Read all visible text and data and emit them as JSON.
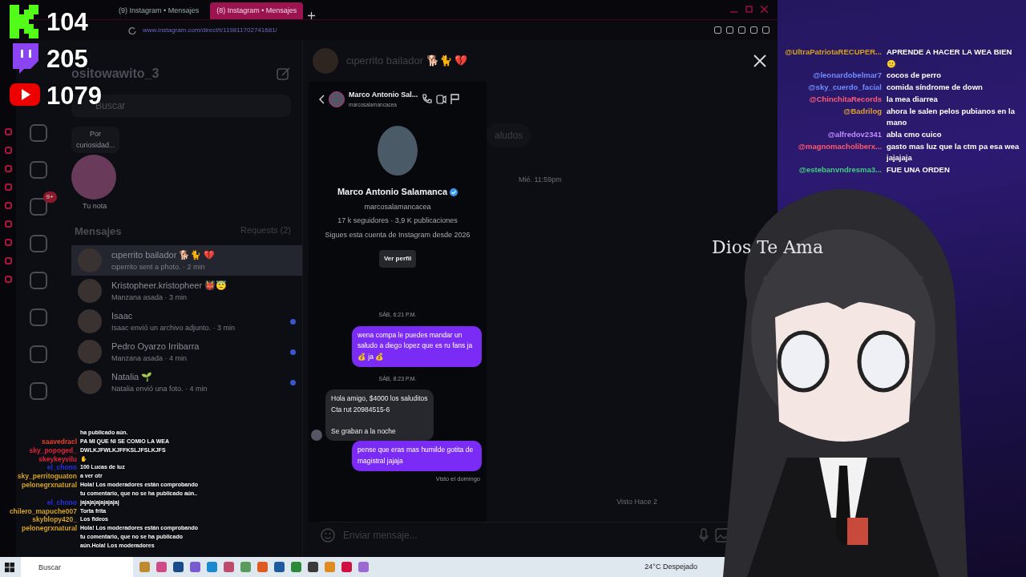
{
  "browser": {
    "tabs": [
      {
        "label": "(9) Instagram • Mensajes",
        "selected": false
      },
      {
        "label": "(8) Instagram • Mensajes",
        "selected": true
      }
    ],
    "url": "www.instagram.com/direct/t/119811702741681/"
  },
  "stream_counters": [
    {
      "kind": "kick",
      "count": "104"
    },
    {
      "kind": "twitch",
      "count": "205"
    },
    {
      "kind": "youtube",
      "count": "1079"
    }
  ],
  "instagram": {
    "username": "ositowawito_3",
    "nav_badge": "9+",
    "search": {
      "placeholder": "Buscar"
    },
    "note": {
      "bubble": "Por curiosidad...",
      "label": "Tu nota"
    },
    "messages_title": "Mensajes",
    "requests": "Requests (2)",
    "conversations": [
      {
        "name": "cɩperrito bailador 🐕🐈 💔",
        "preview": "cɩperrito sent a photo. · 2 min",
        "selected": true,
        "unread": false
      },
      {
        "name": "Kristopheer.kristopheer 👹😇",
        "preview": "Manzana asada · 3 min",
        "selected": false,
        "unread": false
      },
      {
        "name": "Isaac",
        "preview": "Isaac envió un archivo adjunto. · 3 min",
        "selected": false,
        "unread": true
      },
      {
        "name": "Pedro Oyarzo Irribarra",
        "preview": "Manzana asada · 4 min",
        "selected": false,
        "unread": true
      },
      {
        "name": "Natalia 🌱",
        "preview": "Natalia envió una foto. · 4 min",
        "selected": false,
        "unread": true
      }
    ],
    "background_thread": {
      "title": "cɩperrito bailador 🐕🐈 💔",
      "bubble": "aludos",
      "time": "Mié. 11:59pm",
      "seen": "Visto Hace 2"
    },
    "thread": {
      "header_name": "Marco Antonio Sal...",
      "header_handle": "marcosalamancacea",
      "profile_name": "Marco Antonio Salamanca",
      "verified": true,
      "handle": "marcosalamancacea",
      "stats": "17 k seguidores · 3,9 K publicaciones",
      "since": "Sigues esta cuenta de Instagram desde 2026",
      "profile_button": "Ver perfil",
      "messages": [
        {
          "kind": "time",
          "text": "SÁB, 6:21 P.M."
        },
        {
          "kind": "sent",
          "text": "wena compa le puedes mandar un saludo a diego lopez que es ru fans  ja 💰 ja 💰"
        },
        {
          "kind": "time",
          "text": "SÁB, 8:23 P.M."
        },
        {
          "kind": "received",
          "text": "Hola amigo, $4000 los saluditos\nCta rut 20984515-6\n\nSe graban a la noche"
        },
        {
          "kind": "sent",
          "text": "pense que eras mas humilde gotita de magistral jajaja"
        }
      ],
      "seen": "Visto el domingo",
      "composer": {
        "placeholder": "Enviar mensaje..."
      }
    }
  },
  "overlay_chat": {
    "first_line": "ha publicado aún.",
    "lines": [
      {
        "user": "saavedracl",
        "text": "PA MI QUE NI SE COMIO LA WEA",
        "color": "#e8402a"
      },
      {
        "user": "sky_popoged_",
        "text": "DWLKJFWLKJFFKSLJFSLKJFS",
        "color": "#e0203a"
      },
      {
        "user": "skeykeyvilu",
        "text": "✋",
        "color": "#e0203a"
      },
      {
        "user": "el_chono",
        "text": "100 Lucas de luz",
        "color": "#2430e0"
      },
      {
        "user": "sky_perritoguaton",
        "text": "a ver otr",
        "color": "#d6a21e"
      },
      {
        "user": "pelonegrxnatural",
        "text": "Hola! Los moderadores están comprobando tu comentario, que no se ha publicado aún..",
        "color": "#d6a21e"
      },
      {
        "user": "el_chono",
        "text": "jajajajajajajajaj",
        "color": "#2430e0"
      },
      {
        "user": "chilero_mapuche007",
        "text": "Torta frita",
        "color": "#d6a21e"
      },
      {
        "user": "skyblopy420_",
        "text": "Los fideos",
        "color": "#d6a21e"
      },
      {
        "user": "pelonegrxnatural",
        "text": "Hola! Los moderadores están comprobando tu comentario, que no se ha publicado aún.Hola! Los moderadores",
        "color": "#d6a21e"
      }
    ]
  },
  "side_chat": [
    {
      "user": "@UltraPatriotaRECUPER...",
      "text": "APRENDE A HACER LA WEA BIEN 🙁",
      "color": "#d6a21e"
    },
    {
      "user": "@leonardobelmar7",
      "text": "cocos de perro",
      "color": "#6f8cff"
    },
    {
      "user": "@sky_cuerdo_facial",
      "text": "comida síndrome de down",
      "color": "#6f8cff"
    },
    {
      "user": "@ChinchitaRecords",
      "text": "la mea diarrea",
      "color": "#ff5a78"
    },
    {
      "user": "@Badrilog",
      "text": "ahora le salen pelos pubianos en la mano",
      "color": "#e0a030"
    },
    {
      "user": "@alfredov2341",
      "text": "abla cmo cuico",
      "color": "#c08aff"
    },
    {
      "user": "@magnomacholiberx...",
      "text": "gasto mas luz que la ctm pa esa wea jajajaja",
      "color": "#ff5a6a"
    },
    {
      "user": "@estebanvndresma3...",
      "text": "FUE UNA ORDEN",
      "color": "#3fcf7a"
    }
  ],
  "avatar_caption": "Dios Te Ama",
  "taskbar": {
    "search": {
      "placeholder": "Buscar"
    },
    "weather": "24°C  Despejado"
  }
}
